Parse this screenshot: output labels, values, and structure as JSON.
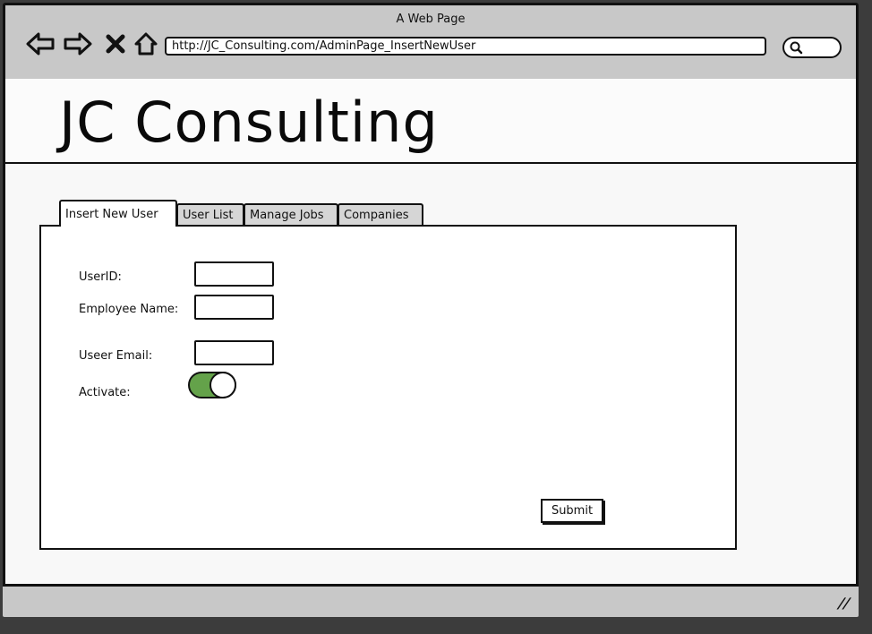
{
  "window": {
    "title": "A Web Page"
  },
  "browser": {
    "url": "http://JC_Consulting.com/AdminPage_InsertNewUser",
    "icons": [
      "back-arrow-icon",
      "forward-arrow-icon",
      "close-x-icon",
      "home-icon",
      "search-icon"
    ]
  },
  "header": {
    "brand": "JC Consulting"
  },
  "tabs": [
    {
      "label": "Insert New User",
      "active": true
    },
    {
      "label": "User List",
      "active": false
    },
    {
      "label": "Manage Jobs",
      "active": false
    },
    {
      "label": "Companies",
      "active": false
    }
  ],
  "form": {
    "userid_label": "UserID:",
    "employee_name_label": "Employee Name:",
    "email_label": "Useer Email:",
    "activate_label": "Activate:",
    "activate_on": true,
    "submit_label": "Submit"
  },
  "colors": {
    "toggle_on": "#64a24a",
    "chrome": "#c8c8c8"
  }
}
